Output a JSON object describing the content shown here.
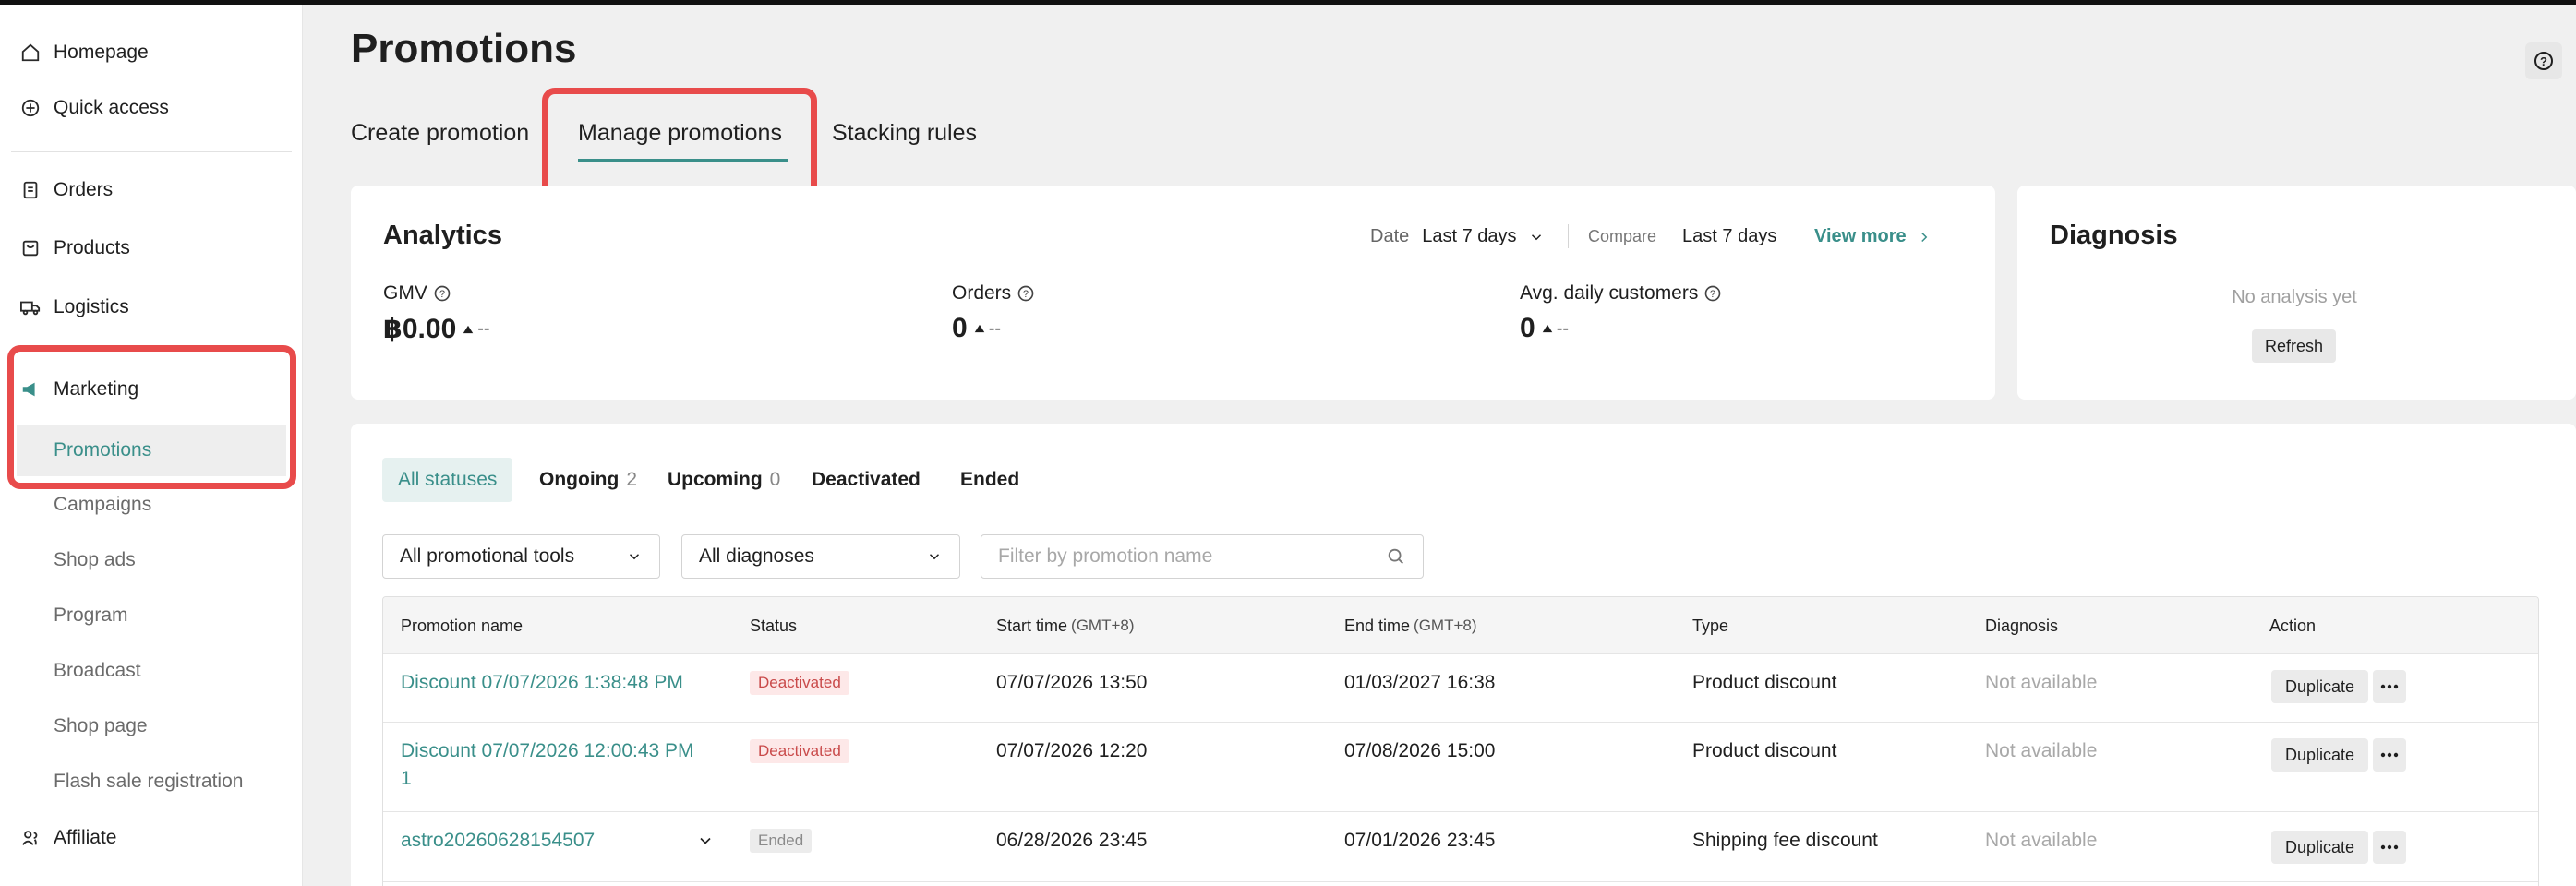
{
  "sidebar": {
    "items": [
      {
        "label": "Homepage",
        "icon": "home-icon"
      },
      {
        "label": "Quick access",
        "icon": "quick-access-icon"
      },
      {
        "label": "Orders",
        "icon": "orders-icon"
      },
      {
        "label": "Products",
        "icon": "products-icon"
      },
      {
        "label": "Logistics",
        "icon": "truck-icon"
      },
      {
        "label": "Marketing",
        "icon": "megaphone-icon"
      }
    ],
    "marketing_sub": [
      "Promotions",
      "Campaigns",
      "Shop ads",
      "Program",
      "Broadcast",
      "Shop page",
      "Flash sale registration"
    ],
    "affiliate": {
      "label": "Affiliate",
      "icon": "affiliate-icon"
    }
  },
  "page": {
    "title": "Promotions"
  },
  "tabs": [
    "Create promotion",
    "Manage promotions",
    "Stacking rules"
  ],
  "analytics": {
    "title": "Analytics",
    "date_label": "Date",
    "date_value": "Last 7 days",
    "compare_label": "Compare",
    "compare_value": "Last 7 days",
    "view_more": "View more",
    "metrics": [
      {
        "label": "GMV",
        "value": "฿0.00",
        "delta": "--"
      },
      {
        "label": "Orders",
        "value": "0",
        "delta": "--"
      },
      {
        "label": "Avg. daily customers",
        "value": "0",
        "delta": "--"
      }
    ]
  },
  "diagnosis": {
    "title": "Diagnosis",
    "empty_text": "No analysis yet",
    "refresh_label": "Refresh"
  },
  "status_tabs": [
    {
      "label": "All statuses",
      "count": ""
    },
    {
      "label": "Ongoing",
      "count": "2"
    },
    {
      "label": "Upcoming",
      "count": "0"
    },
    {
      "label": "Deactivated",
      "count": ""
    },
    {
      "label": "Ended",
      "count": ""
    }
  ],
  "filters": {
    "tool_select": "All promotional tools",
    "diagnosis_select": "All diagnoses",
    "search_placeholder": "Filter by promotion name"
  },
  "table": {
    "headers": {
      "name": "Promotion name",
      "status": "Status",
      "start": "Start time",
      "end": "End time",
      "tz": "(GMT+8)",
      "type": "Type",
      "diagnosis": "Diagnosis",
      "action": "Action"
    },
    "rows": [
      {
        "name": "Discount 07/07/2026 1:38:48 PM",
        "name2": "",
        "status": "Deactivated",
        "start": "07/07/2026 13:50",
        "end": "01/03/2027 16:38",
        "type": "Product discount",
        "diagnosis": "Not available",
        "action": "Duplicate"
      },
      {
        "name": "Discount 07/07/2026 12:00:43 PM",
        "name2": "1",
        "status": "Deactivated",
        "start": "07/07/2026 12:20",
        "end": "07/08/2026 15:00",
        "type": "Product discount",
        "diagnosis": "Not available",
        "action": "Duplicate"
      },
      {
        "name": "astro20260628154507",
        "name2": "",
        "status": "Ended",
        "start": "06/28/2026 23:45",
        "end": "07/01/2026 23:45",
        "type": "Shipping fee discount",
        "diagnosis": "Not available",
        "action": "Duplicate"
      }
    ]
  },
  "colors": {
    "accent": "#3a8f8a",
    "highlight": "#e84b4b",
    "deactivated_bg": "#fde8e8",
    "deactivated_text": "#c94a4a"
  }
}
